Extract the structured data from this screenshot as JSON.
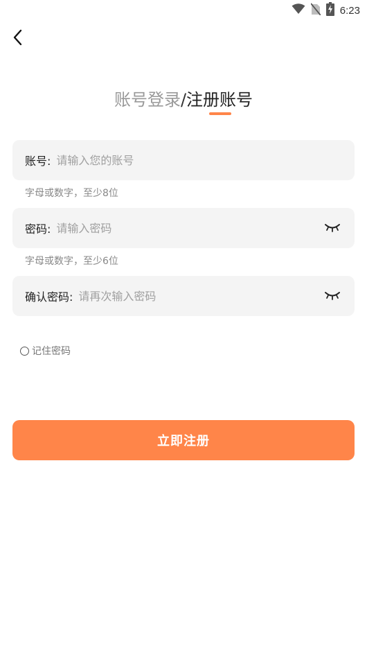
{
  "status_bar": {
    "time": "6:23",
    "icons": [
      "wifi-icon",
      "no-sim-icon",
      "battery-charging-icon"
    ]
  },
  "header": {
    "back_icon": "chevron-left-icon",
    "tab_login": "账号登录",
    "separator": "/",
    "tab_register": "注册账号",
    "active_tab": "注册账号",
    "accent_color": "#ff8549"
  },
  "form": {
    "account": {
      "label": "账号:",
      "placeholder": "请输入您的账号",
      "value": "",
      "hint": "字母或数字，至少8位"
    },
    "password": {
      "label": "密码:",
      "placeholder": "请输入密码",
      "value": "",
      "hint": "字母或数字，至少6位",
      "toggle_icon": "eye-closed-icon"
    },
    "confirm_password": {
      "label": "确认密码:",
      "placeholder": "请再次输入密码",
      "value": "",
      "toggle_icon": "eye-closed-icon"
    },
    "remember_password": {
      "label": "记住密码",
      "checked": false
    },
    "submit_label": "立即注册"
  },
  "colors": {
    "primary": "#ff8549",
    "field_background": "#f4f4f4",
    "placeholder": "#a0a0a0",
    "hint": "#888888"
  }
}
